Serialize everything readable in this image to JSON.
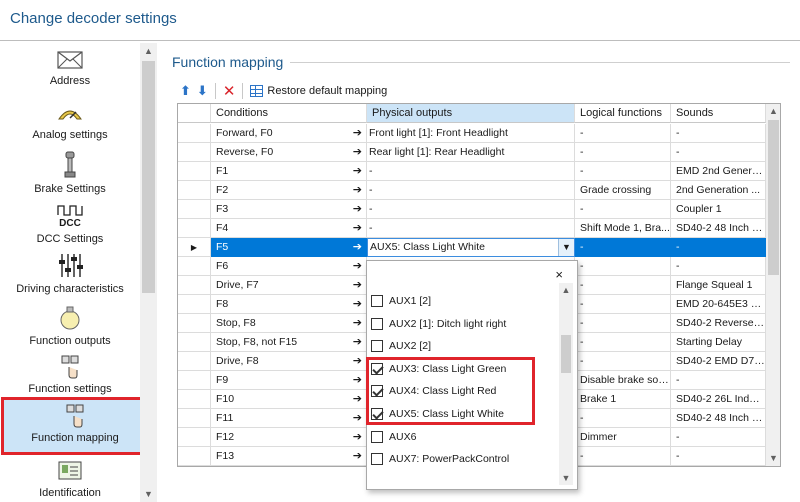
{
  "window": {
    "title": "Change decoder settings"
  },
  "sidebar": {
    "items": [
      {
        "label": "Address",
        "icon": "envelope-icon"
      },
      {
        "label": "Analog settings",
        "icon": "gauge-icon"
      },
      {
        "label": "Brake Settings",
        "icon": "brake-icon"
      },
      {
        "label": "DCC Settings",
        "icon": "dcc-icon",
        "icon_text": "DCC"
      },
      {
        "label": "Driving characteristics",
        "icon": "sliders-icon"
      },
      {
        "label": "Function outputs",
        "icon": "light-bulb-icon"
      },
      {
        "label": "Function settings",
        "icon": "function-settings-icon"
      },
      {
        "label": "Function mapping",
        "icon": "function-mapping-icon",
        "selected": true
      },
      {
        "label": "Identification",
        "icon": "id-card-icon"
      }
    ]
  },
  "group": {
    "title": "Function mapping"
  },
  "toolbar": {
    "restore_label": "Restore default mapping"
  },
  "table": {
    "columns": [
      "Conditions",
      "Physical outputs",
      "Logical functions",
      "Sounds"
    ],
    "rows": [
      {
        "cond": "Forward, F0",
        "phys": "Front light [1]: Front Headlight",
        "log": "-",
        "snd": "-"
      },
      {
        "cond": "Reverse, F0",
        "phys": "Rear light [1]: Rear Headlight",
        "log": "-",
        "snd": "-"
      },
      {
        "cond": "F1",
        "phys": "-",
        "log": "-",
        "snd": "EMD 2nd Genera..."
      },
      {
        "cond": "F2",
        "phys": "-",
        "log": "Grade crossing",
        "snd": "2nd Generation ..."
      },
      {
        "cond": "F3",
        "phys": "-",
        "log": "-",
        "snd": "Coupler 1"
      },
      {
        "cond": "F4",
        "phys": "-",
        "log": "Shift Mode 1, Bra...",
        "snd": "SD40-2 48 Inch O..."
      },
      {
        "cond": "F5",
        "phys": "AUX5: Class Light White",
        "log": "-",
        "snd": "-",
        "selected": true
      },
      {
        "cond": "F6",
        "phys": "",
        "log": "-",
        "snd": "-"
      },
      {
        "cond": "Drive, F7",
        "phys": "",
        "log": "-",
        "snd": "Flange Squeal 1"
      },
      {
        "cond": "F8",
        "phys": "",
        "log": "-",
        "snd": "EMD 20-645E3 N..."
      },
      {
        "cond": "Stop, F8",
        "phys": "",
        "log": "-",
        "snd": "SD40-2 Reverser 1"
      },
      {
        "cond": "Stop, F8, not F15",
        "phys": "",
        "log": "-",
        "snd": "Starting Delay"
      },
      {
        "cond": "Drive, F8",
        "phys": "",
        "log": "-",
        "snd": "SD40-2 EMD D77 ..."
      },
      {
        "cond": "F9",
        "phys": "",
        "log": "Disable brake sou...",
        "snd": "-"
      },
      {
        "cond": "F10",
        "phys": "",
        "log": "Brake 1",
        "snd": "SD40-2 26L Indep..."
      },
      {
        "cond": "F11",
        "phys": "",
        "log": "-",
        "snd": "SD40-2 48 Inch O..."
      },
      {
        "cond": "F12",
        "phys": "",
        "log": "Dimmer",
        "snd": "-"
      },
      {
        "cond": "F13",
        "phys": "",
        "log": "-",
        "snd": "-"
      }
    ]
  },
  "dropdown": {
    "value": "AUX5: Class Light White",
    "close_label": "×",
    "options": [
      {
        "label": "AUX1 [2]",
        "checked": false
      },
      {
        "label": "AUX2 [1]: Ditch light right",
        "checked": false
      },
      {
        "label": "AUX2 [2]",
        "checked": false
      },
      {
        "label": "AUX3: Class Light Green",
        "checked": true
      },
      {
        "label": "AUX4: Class Light Red",
        "checked": true
      },
      {
        "label": "AUX5: Class Light White",
        "checked": true
      },
      {
        "label": "AUX6",
        "checked": false
      },
      {
        "label": "AUX7: PowerPackControl",
        "checked": false
      }
    ]
  },
  "colors": {
    "accent": "#1e5a8c",
    "selection": "#0078d7",
    "highlight": "#e0242b",
    "sidebar_selected": "#cce4f7"
  }
}
